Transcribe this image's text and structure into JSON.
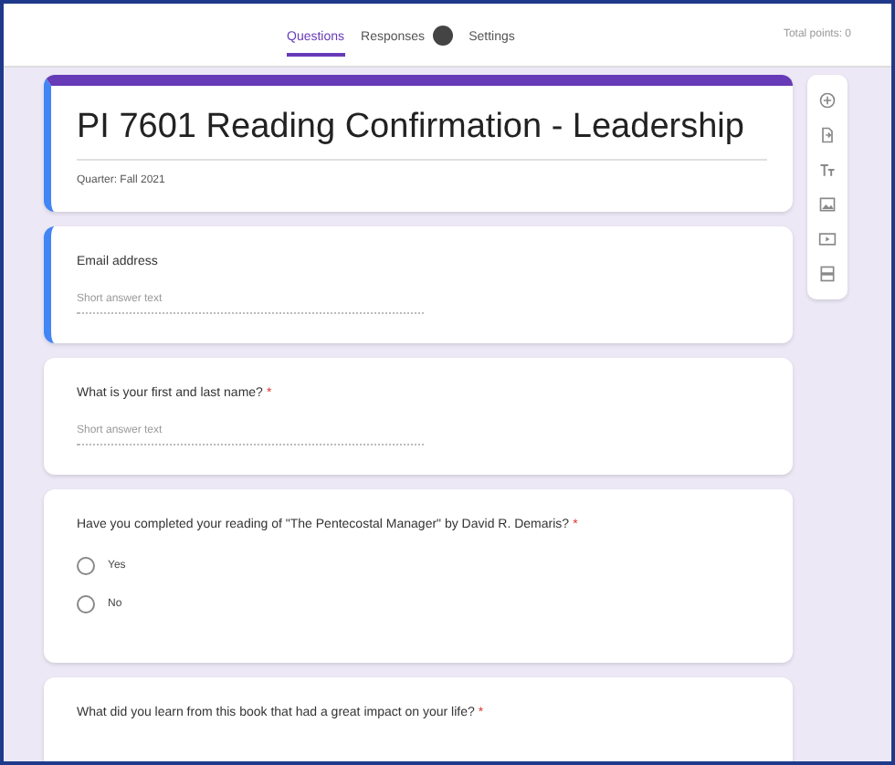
{
  "tabs": [
    {
      "label": "Questions",
      "selected": true
    },
    {
      "label": "Responses",
      "selected": false,
      "badge": true
    },
    {
      "label": "Settings",
      "selected": false
    }
  ],
  "total_points": "Total points: 0",
  "form": {
    "title": "PI 7601 Reading Confirmation - Leadership",
    "description": "Quarter: Fall 2021",
    "selected": true
  },
  "questions": [
    {
      "kind": "short_answer",
      "label": "Email address",
      "placeholder": "Short answer text",
      "required": false,
      "selected": true
    },
    {
      "kind": "short_answer",
      "label": "What is your first and last name?",
      "placeholder": "Short answer text",
      "required": true,
      "selected": false
    },
    {
      "kind": "radio",
      "label": "Have you completed your reading of \"The Pentecostal Manager\" by David R. Demaris?",
      "options": [
        "Yes",
        "No"
      ],
      "required": true,
      "selected": false
    },
    {
      "kind": "paragraph",
      "label": "What did you learn from this book that had a great impact on your life?",
      "required": true,
      "selected": false
    }
  ],
  "required_mark": "*",
  "toolbar": [
    {
      "kind": "add-question"
    },
    {
      "kind": "import-questions"
    },
    {
      "kind": "add-title"
    },
    {
      "kind": "add-image"
    },
    {
      "kind": "add-video"
    },
    {
      "kind": "add-section"
    }
  ]
}
